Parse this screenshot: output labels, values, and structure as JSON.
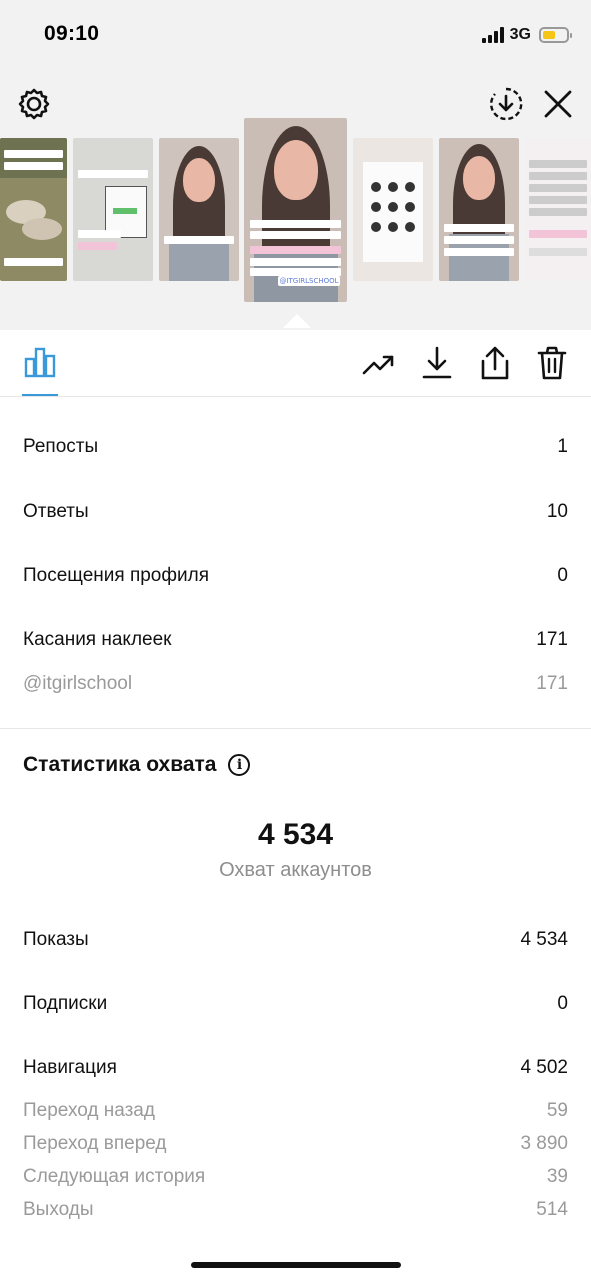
{
  "status_bar": {
    "time": "09:10",
    "network": "3G",
    "battery_level": 0.4,
    "battery_color": "#f5c518"
  },
  "top_bar": {
    "settings_icon": "gear-icon",
    "download_icon": "download-circle-icon",
    "close_icon": "close-icon"
  },
  "stories": [
    {
      "name": "story-thumb-1",
      "kind": "sheep-photo"
    },
    {
      "name": "story-thumb-2",
      "kind": "phone-screenshot"
    },
    {
      "name": "story-thumb-3",
      "kind": "portrait"
    },
    {
      "name": "story-thumb-4",
      "kind": "portrait",
      "active": true,
      "tag": "@ITGIRLSCHOOL"
    },
    {
      "name": "story-thumb-5",
      "kind": "illustrations"
    },
    {
      "name": "story-thumb-6",
      "kind": "portrait"
    },
    {
      "name": "story-thumb-7",
      "kind": "text-screenshot"
    }
  ],
  "tabs": {
    "stats_icon": "bar-chart-icon",
    "actions": [
      "trending-icon",
      "download-icon",
      "share-icon",
      "trash-icon"
    ],
    "accent": "#3a9ad9"
  },
  "interactions": [
    {
      "label": "Репосты",
      "value": "1"
    },
    {
      "label": "Ответы",
      "value": "10"
    },
    {
      "label": "Посещения профиля",
      "value": "0"
    },
    {
      "label": "Касания наклеек",
      "value": "171"
    }
  ],
  "sticker_detail": {
    "label": "@itgirlschool",
    "value": "171"
  },
  "reach": {
    "title": "Статистика охвата",
    "total": "4 534",
    "total_label": "Охват аккаунтов",
    "rows": [
      {
        "label": "Показы",
        "value": "4 534"
      },
      {
        "label": "Подписки",
        "value": "0"
      },
      {
        "label": "Навигация",
        "value": "4 502"
      }
    ],
    "navigation_details": [
      {
        "label": "Переход назад",
        "value": "59"
      },
      {
        "label": "Переход вперед",
        "value": "3 890"
      },
      {
        "label": "Следующая история",
        "value": "39"
      },
      {
        "label": "Выходы",
        "value": "514"
      }
    ]
  }
}
